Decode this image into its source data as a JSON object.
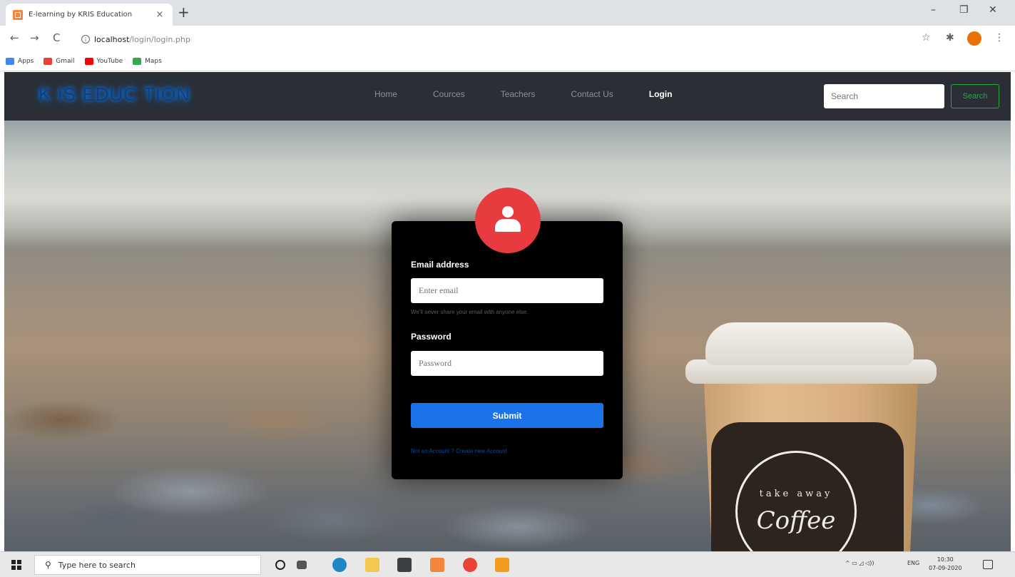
{
  "browser": {
    "tab_title": "E-learning by KRIS Education",
    "tab_close": "×",
    "new_tab": "+",
    "window_controls": {
      "minimize": "–",
      "restore": "❐",
      "close": "✕"
    },
    "nav": {
      "back": "←",
      "forward": "→",
      "reload": "C"
    },
    "url_host": "localhost",
    "url_path": "/login/login.php",
    "bookmarks": [
      {
        "label": "Apps",
        "color": "#4285f4"
      },
      {
        "label": "Gmail",
        "color": "#ea4335"
      },
      {
        "label": "YouTube",
        "color": "#ff0000"
      },
      {
        "label": "Maps",
        "color": "#34a853"
      }
    ]
  },
  "site": {
    "brand": "K  IS EDUC  TION",
    "nav_links": [
      "Home",
      "Cources",
      "Teachers",
      "Contact Us",
      "Login"
    ],
    "active_link": "Login",
    "search_placeholder": "Search",
    "search_button": "Search",
    "colors": {
      "navbar": "#2b2f35",
      "search_btn": "#28a745",
      "submit": "#1a73e8",
      "avatar": "#e83b3f"
    }
  },
  "login": {
    "email_label": "Email address",
    "email_placeholder": "Enter email",
    "email_help": "We'll never share your email with anyone else.",
    "password_label": "Password",
    "password_placeholder": "Password",
    "submit_label": "Submit",
    "signup_text": "Not an Account ? Create new Account"
  },
  "hero": {
    "cup_ring_text": "take away",
    "cup_main_text": "Coffee"
  },
  "taskbar": {
    "search_placeholder": "Type here to search",
    "tray_lang": "ENG",
    "time": "10:30",
    "date": "07-09-2020"
  }
}
